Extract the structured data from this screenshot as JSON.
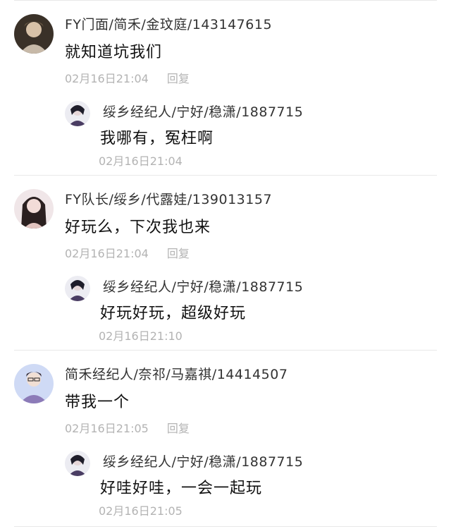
{
  "comments": [
    {
      "author": "FY门面/简禾/金玟庭/143147615",
      "text": "就知道坑我们",
      "time": "02月16日21:04",
      "reply_label": "回复",
      "avatar_colors": [
        "#3a3128",
        "#c7b9a8"
      ],
      "reply": {
        "author": "绥乡经纪人/宁好/稳潇/1887715",
        "text": "我哪有，冤枉啊",
        "time": "02月16日21:04",
        "avatar_colors": [
          "#1e1d2a",
          "#b9a9c7"
        ]
      }
    },
    {
      "author": "FY队长/绥乡/代露娃/139013157",
      "text": "好玩么，下次我也来",
      "time": "02月16日21:04",
      "reply_label": "回复",
      "avatar_colors": [
        "#2b2020",
        "#e2c4c0"
      ],
      "reply": {
        "author": "绥乡经纪人/宁好/稳潇/1887715",
        "text": "好玩好玩，超级好玩",
        "time": "02月16日21:10",
        "avatar_colors": [
          "#1e1d2a",
          "#b9a9c7"
        ]
      }
    },
    {
      "author": "简禾经纪人/奈祁/马嘉祺/14414507",
      "text": "带我一个",
      "time": "02月16日21:05",
      "reply_label": "回复",
      "avatar_colors": [
        "#a9b9e6",
        "#5b4a7a"
      ],
      "reply": {
        "author": "绥乡经纪人/宁好/稳潇/1887715",
        "text": "好哇好哇，一会一起玩",
        "time": "02月16日21:05",
        "avatar_colors": [
          "#1e1d2a",
          "#b9a9c7"
        ]
      }
    }
  ]
}
